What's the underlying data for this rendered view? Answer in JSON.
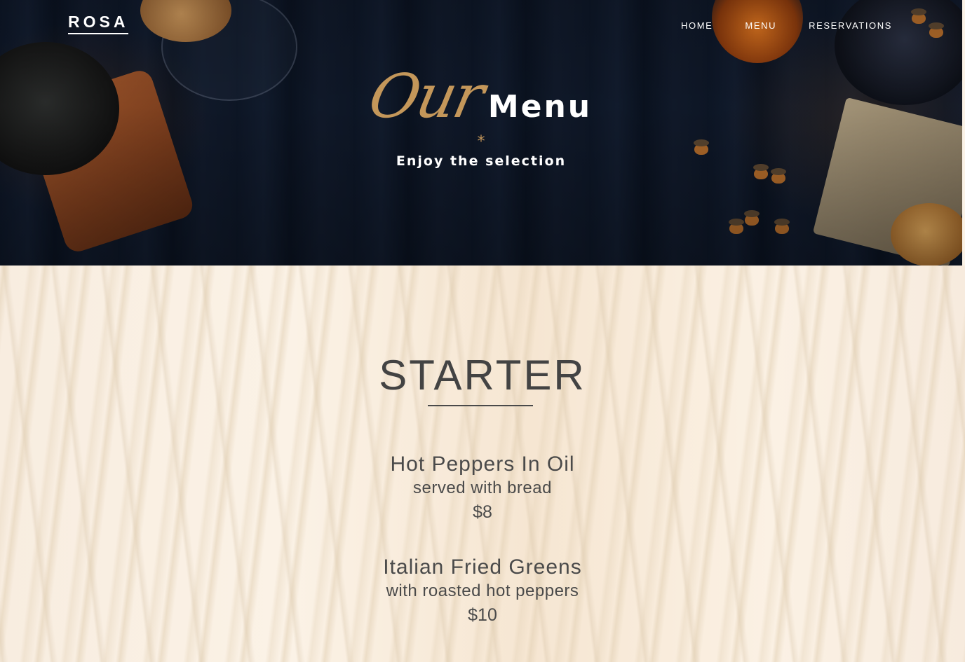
{
  "brand": {
    "logo": "ROSA"
  },
  "nav": {
    "items": [
      {
        "label": "HOME"
      },
      {
        "label": "MENU"
      },
      {
        "label": "RESERVATIONS"
      }
    ]
  },
  "hero": {
    "script_word": "Our",
    "bold_word": "Menu",
    "ornament": "*",
    "subtitle": "Enjoy the selection"
  },
  "menu": {
    "section_title": "STARTER",
    "items": [
      {
        "name": "Hot Peppers In Oil",
        "description": "served with bread",
        "price": "$8"
      },
      {
        "name": "Italian Fried Greens",
        "description": "with roasted hot peppers",
        "price": "$10"
      }
    ]
  },
  "colors": {
    "accent_gold": "#c4975a",
    "hero_dark": "#0e1626",
    "menu_text": "#434343",
    "menu_bg": "#fbf3e8"
  }
}
